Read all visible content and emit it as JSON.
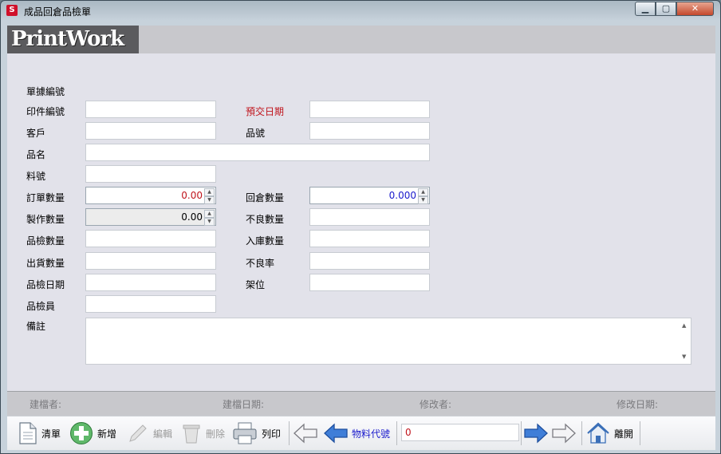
{
  "window": {
    "title": "成品回倉品檢單",
    "icon": "app-s-icon",
    "controls": [
      "minimize",
      "maximize",
      "close"
    ]
  },
  "brand": {
    "logo_text": "PrintWork"
  },
  "form": {
    "doc_no_label": "單據編號",
    "print_no_label": "印件編號",
    "due_date_label": "預交日期",
    "customer_label": "客戶",
    "product_no_label": "品號",
    "product_name_label": "品名",
    "material_no_label": "料號",
    "order_qty_label": "訂單數量",
    "order_qty_value": "0.00",
    "return_qty_label": "回倉數量",
    "return_qty_value": "0.000",
    "made_qty_label": "製作數量",
    "made_qty_value": "0.00",
    "defect_qty_label": "不良數量",
    "inspect_qty_label": "品檢數量",
    "stock_in_qty_label": "入庫數量",
    "ship_qty_label": "出貨數量",
    "defect_rate_label": "不良率",
    "inspect_date_label": "品檢日期",
    "shelf_label": "架位",
    "inspector_label": "品檢員",
    "remarks_label": "備註",
    "colors": {
      "accent_red": "#c0141c",
      "value_blue": "#1a1acc"
    }
  },
  "info_bar": {
    "created_by": "建檔者:",
    "created_date": "建檔日期:",
    "modified_by": "修改者:",
    "modified_date": "修改日期:"
  },
  "toolbar": {
    "clear": "清單",
    "add": "新增",
    "edit": "編輯",
    "delete": "刪除",
    "print": "列印",
    "material_code": "物料代號",
    "material_code_value": "0",
    "exit": "離開"
  }
}
